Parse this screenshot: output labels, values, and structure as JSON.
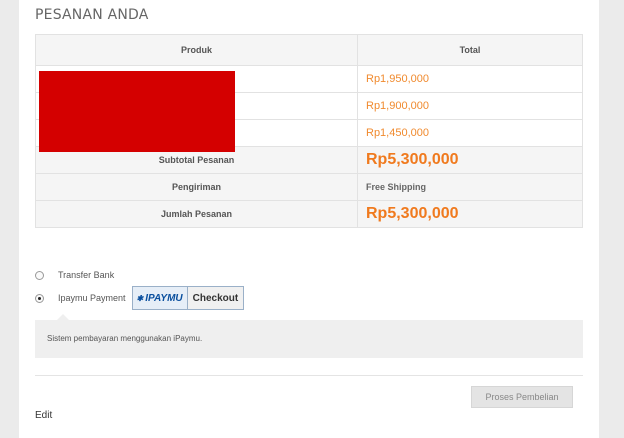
{
  "section_title": "PESANAN ANDA",
  "table": {
    "header": {
      "product": "Produk",
      "total": "Total"
    },
    "rows": [
      {
        "total": "Rp1,950,000"
      },
      {
        "total": "Rp1,900,000"
      },
      {
        "total": "Rp1,450,000"
      }
    ],
    "subtotal": {
      "label": "Subtotal Pesanan",
      "value": "Rp5,300,000"
    },
    "shipping": {
      "label": "Pengiriman",
      "value": "Free Shipping"
    },
    "grand_total": {
      "label": "Jumlah Pesanan",
      "value": "Rp5,300,000"
    }
  },
  "payment": {
    "options": [
      {
        "label": "Transfer Bank",
        "selected": false
      },
      {
        "label": "Ipaymu Payment",
        "selected": true
      }
    ],
    "ipaymu_button": {
      "logo": "IPAYMU",
      "action": "Checkout"
    },
    "description": "Sistem pembayaran menggunakan iPaymu."
  },
  "actions": {
    "submit_label": "Proses Pembelian",
    "edit_label": "Edit"
  },
  "colors": {
    "accent_price": "#f07a1e",
    "redaction": "#d40000"
  }
}
